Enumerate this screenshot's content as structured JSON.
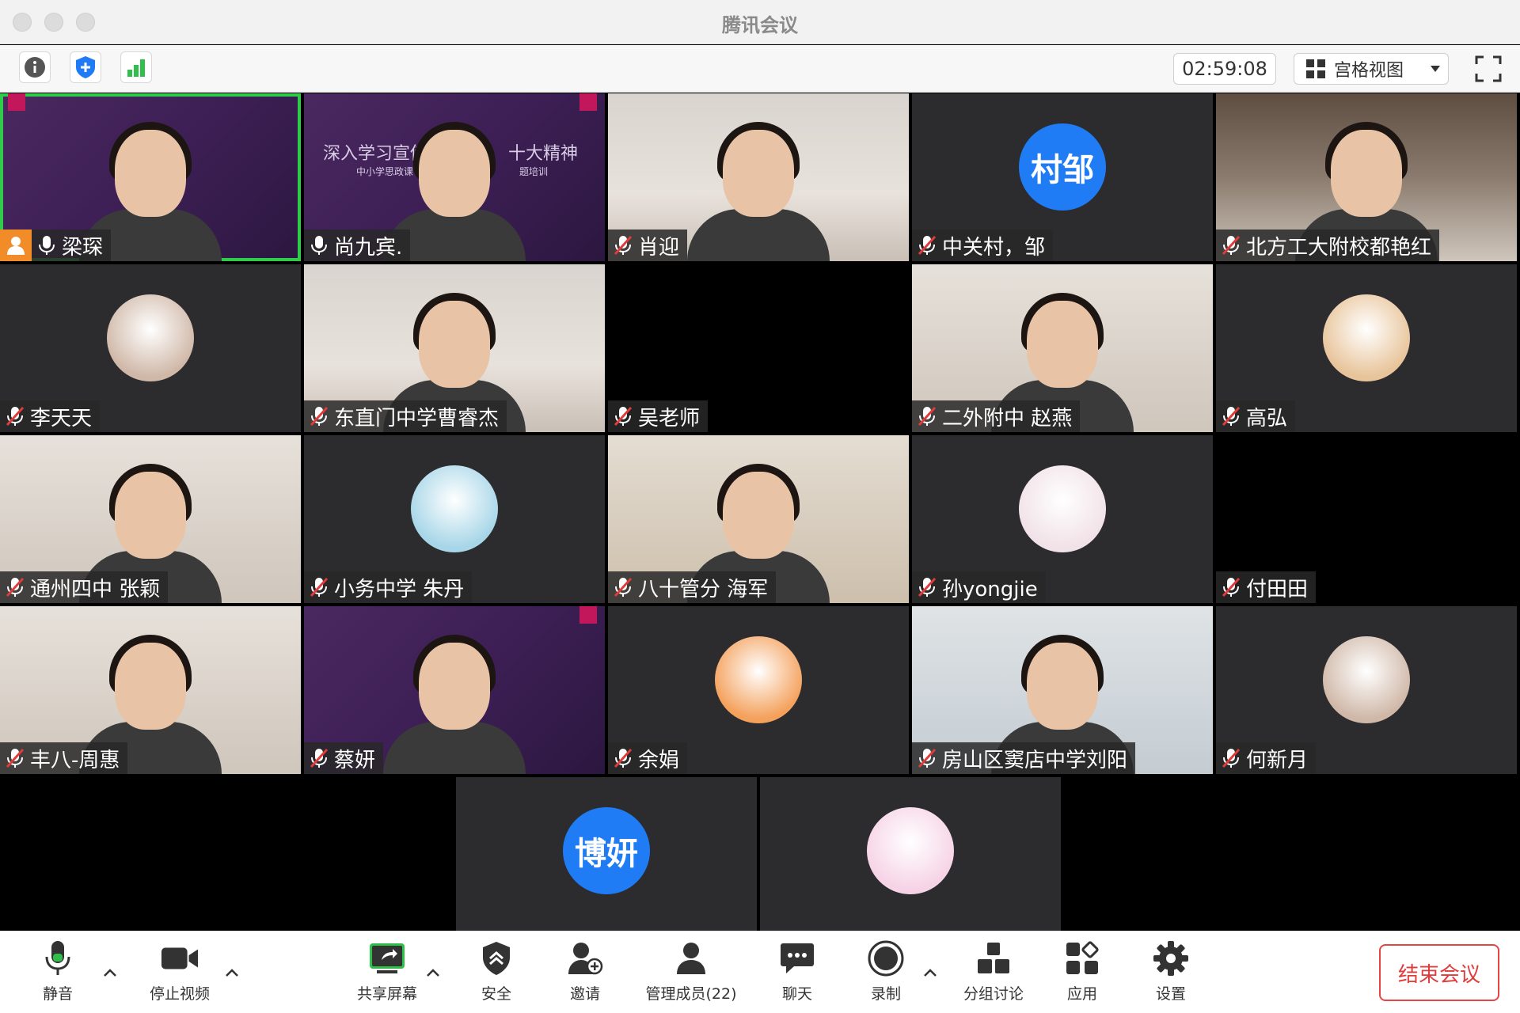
{
  "window": {
    "title": "腾讯会议"
  },
  "toolbar": {
    "timer": "02:59:08",
    "view_label": "宫格视图"
  },
  "tiles": [
    {
      "name": "梁琛",
      "muted": false,
      "host": true,
      "type": "video",
      "bg": "purple",
      "active": true
    },
    {
      "name": "尚九宾.",
      "muted": false,
      "host": false,
      "type": "video",
      "bg": "purple"
    },
    {
      "name": "肖迎",
      "muted": true,
      "type": "video",
      "bg": "room"
    },
    {
      "name": "中关村，邹",
      "muted": true,
      "type": "avatar",
      "avatar_text": "村邹"
    },
    {
      "name": "北方工大附校都艳红",
      "muted": true,
      "type": "video",
      "bg": "shelf"
    },
    {
      "name": "李天天",
      "muted": true,
      "type": "avatar-img"
    },
    {
      "name": "东直门中学曹睿杰",
      "muted": true,
      "type": "video",
      "bg": "room"
    },
    {
      "name": "吴老师",
      "muted": true,
      "type": "black"
    },
    {
      "name": "二外附中 赵燕",
      "muted": true,
      "type": "video",
      "bg": "office"
    },
    {
      "name": "高弘",
      "muted": true,
      "type": "avatar-img"
    },
    {
      "name": "通州四中 张颖",
      "muted": true,
      "type": "video",
      "bg": "office"
    },
    {
      "name": "小务中学 朱丹",
      "muted": true,
      "type": "avatar-img"
    },
    {
      "name": "八十管分 海军",
      "muted": true,
      "type": "video",
      "bg": "warm"
    },
    {
      "name": "孙yongjie",
      "muted": true,
      "type": "avatar-img"
    },
    {
      "name": "付田田",
      "muted": true,
      "type": "black"
    },
    {
      "name": "丰八-周惠",
      "muted": true,
      "type": "video",
      "bg": "office"
    },
    {
      "name": "蔡妍",
      "muted": true,
      "type": "video",
      "bg": "purple"
    },
    {
      "name": "余娟",
      "muted": true,
      "type": "avatar-img"
    },
    {
      "name": "房山区窦店中学刘阳",
      "muted": true,
      "type": "video",
      "bg": "kitchen"
    },
    {
      "name": "何新月",
      "muted": true,
      "type": "avatar-img"
    },
    {
      "name": "",
      "muted": true,
      "type": "avatar",
      "avatar_text": "博妍"
    },
    {
      "name": "",
      "muted": true,
      "type": "avatar-img"
    }
  ],
  "slide": {
    "title_left": "深入学习宣传贯",
    "title_right": "十大精神",
    "sub_left": "中小学思政课",
    "sub_right": "题培训"
  },
  "bottombar": {
    "mute": "静音",
    "stop_video": "停止视频",
    "share": "共享屏幕",
    "security": "安全",
    "invite": "邀请",
    "members": "管理成员(22)",
    "chat": "聊天",
    "record": "录制",
    "breakout": "分组讨论",
    "apps": "应用",
    "settings": "设置",
    "end": "结束会议"
  },
  "colors": {
    "accent": "#1f7cf5",
    "active_border": "#2fcc4c",
    "end": "#e03c3c"
  }
}
